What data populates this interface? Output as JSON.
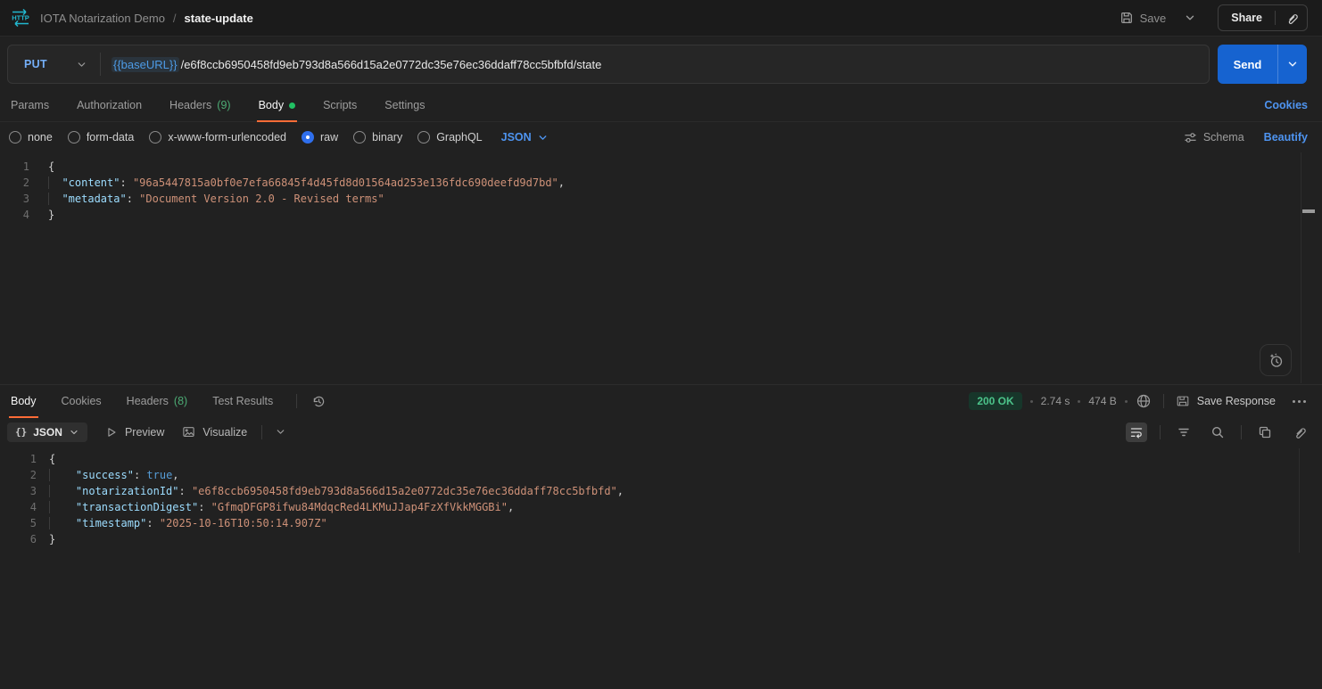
{
  "header": {
    "http_badge": "HTTP",
    "collection_name": "IOTA Notarization Demo",
    "breadcrumb_separator": "/",
    "request_name": "state-update",
    "save_label": "Save",
    "share_label": "Share"
  },
  "request": {
    "method": "PUT",
    "base_url_variable": "{{baseURL}}",
    "url_path": "/e6f8ccb6950458fd9eb793d8a566d15a2e0772dc35e76ec36ddaff78cc5bfbfd/state",
    "send_label": "Send",
    "tabs": [
      {
        "label": "Params"
      },
      {
        "label": "Authorization"
      },
      {
        "label": "Headers",
        "count": "(9)"
      },
      {
        "label": "Body"
      },
      {
        "label": "Scripts"
      },
      {
        "label": "Settings"
      }
    ],
    "active_tab": "Body",
    "cookies_link": "Cookies",
    "body_types": [
      {
        "label": "none"
      },
      {
        "label": "form-data"
      },
      {
        "label": "x-www-form-urlencoded"
      },
      {
        "label": "raw"
      },
      {
        "label": "binary"
      },
      {
        "label": "GraphQL"
      }
    ],
    "selected_body_type": "raw",
    "raw_language": "JSON",
    "schema_label": "Schema",
    "beautify_label": "Beautify",
    "body_code": [
      {
        "num": "1",
        "tokens": [
          {
            "c": "p",
            "v": "{"
          }
        ]
      },
      {
        "num": "2",
        "tokens": [
          {
            "c": "g",
            "v": "  "
          },
          {
            "c": "k",
            "v": "\"content\""
          },
          {
            "c": "p",
            "v": ": "
          },
          {
            "c": "s",
            "v": "\"96a5447815a0bf0e7efa66845f4d45fd8d01564ad253e136fdc690deefd9d7bd\""
          },
          {
            "c": "p",
            "v": ","
          }
        ]
      },
      {
        "num": "3",
        "tokens": [
          {
            "c": "g",
            "v": "  "
          },
          {
            "c": "k",
            "v": "\"metadata\""
          },
          {
            "c": "p",
            "v": ": "
          },
          {
            "c": "s",
            "v": "\"Document Version 2.0 - Revised terms\""
          }
        ]
      },
      {
        "num": "4",
        "tokens": [
          {
            "c": "p",
            "v": "}"
          }
        ]
      }
    ]
  },
  "response": {
    "tabs": [
      {
        "label": "Body"
      },
      {
        "label": "Cookies"
      },
      {
        "label": "Headers",
        "count": "(8)"
      },
      {
        "label": "Test Results"
      }
    ],
    "active_tab": "Body",
    "status": {
      "code_text": "200 OK",
      "time": "2.74 s",
      "size": "474 B"
    },
    "save_response_label": "Save Response",
    "format_selected": "JSON",
    "braces_glyph": "{}",
    "preview_label": "Preview",
    "visualize_label": "Visualize",
    "body_code": [
      {
        "num": "1",
        "tokens": [
          {
            "c": "p",
            "v": "{"
          }
        ]
      },
      {
        "num": "2",
        "tokens": [
          {
            "c": "g",
            "v": "    "
          },
          {
            "c": "k",
            "v": "\"success\""
          },
          {
            "c": "p",
            "v": ": "
          },
          {
            "c": "b",
            "v": "true"
          },
          {
            "c": "p",
            "v": ","
          }
        ]
      },
      {
        "num": "3",
        "tokens": [
          {
            "c": "g",
            "v": "    "
          },
          {
            "c": "k",
            "v": "\"notarizationId\""
          },
          {
            "c": "p",
            "v": ": "
          },
          {
            "c": "s",
            "v": "\"e6f8ccb6950458fd9eb793d8a566d15a2e0772dc35e76ec36ddaff78cc5bfbfd\""
          },
          {
            "c": "p",
            "v": ","
          }
        ]
      },
      {
        "num": "4",
        "tokens": [
          {
            "c": "g",
            "v": "    "
          },
          {
            "c": "k",
            "v": "\"transactionDigest\""
          },
          {
            "c": "p",
            "v": ": "
          },
          {
            "c": "s",
            "v": "\"GfmqDFGP8ifwu84MdqcRed4LKMuJJap4FzXfVkkMGGBi\""
          },
          {
            "c": "p",
            "v": ","
          }
        ]
      },
      {
        "num": "5",
        "tokens": [
          {
            "c": "g",
            "v": "    "
          },
          {
            "c": "k",
            "v": "\"timestamp\""
          },
          {
            "c": "p",
            "v": ": "
          },
          {
            "c": "s",
            "v": "\"2025-10-16T10:50:14.907Z\""
          }
        ]
      },
      {
        "num": "6",
        "tokens": [
          {
            "c": "p",
            "v": "}"
          }
        ]
      }
    ]
  },
  "colors": {
    "accent_orange": "#ff6c37",
    "send_button_blue": "#1663d0",
    "link_blue": "#4e94f0",
    "method_put_blue": "#74aef6",
    "success_green": "#4cc38a",
    "status_pill_bg": "#17362a",
    "http_badge_teal": "#22b8cf",
    "code_key": "#9cdcfe",
    "code_string": "#ce9178",
    "code_boolean": "#569cd6"
  }
}
